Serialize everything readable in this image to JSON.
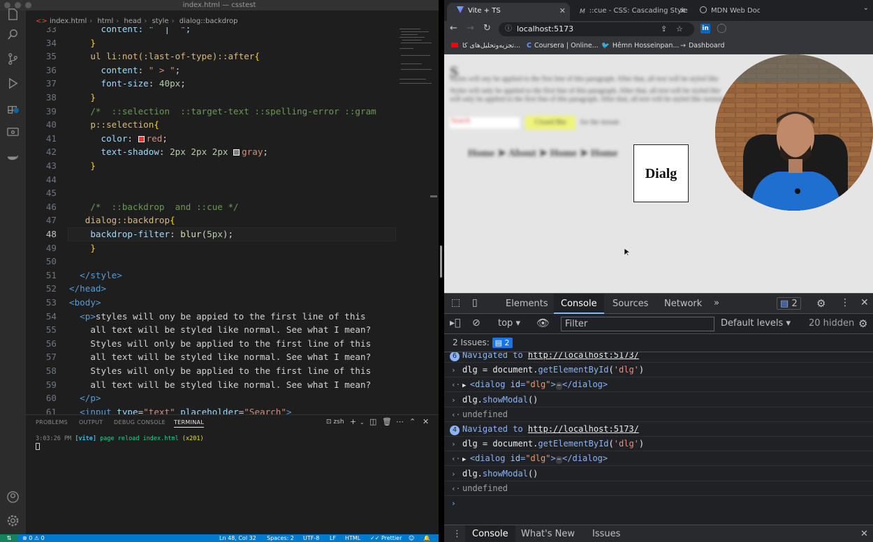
{
  "vscode": {
    "window_title": "index.html — csstest",
    "breadcrumbs": [
      "index.html",
      "html",
      "head",
      "style",
      "dialog::backdrop"
    ],
    "lines": [
      {
        "n": "33",
        "cur": false,
        "tokens": [
          {
            "t": "      content: \"  |  \";",
            "c": "t-prop"
          }
        ]
      },
      {
        "n": "34",
        "cur": false,
        "tokens": [
          {
            "t": "    }",
            "c": "t-br"
          }
        ]
      },
      {
        "n": "35",
        "cur": false,
        "tokens": [
          {
            "t": "    ul li:not(:last-of-type)::after",
            "c": "t-sel"
          },
          {
            "t": "{",
            "c": "t-br"
          }
        ]
      },
      {
        "n": "36",
        "cur": false,
        "tokens": [
          {
            "t": "      content",
            "c": "t-prop"
          },
          {
            "t": ": ",
            "c": ""
          },
          {
            "t": "\" > \"",
            "c": "t-str"
          },
          {
            "t": ";",
            "c": ""
          }
        ]
      },
      {
        "n": "37",
        "cur": false,
        "tokens": [
          {
            "t": "      font-size",
            "c": "t-prop"
          },
          {
            "t": ": ",
            "c": ""
          },
          {
            "t": "40px",
            "c": "t-num"
          },
          {
            "t": ";",
            "c": ""
          }
        ]
      },
      {
        "n": "38",
        "cur": false,
        "tokens": [
          {
            "t": "    }",
            "c": "t-br"
          }
        ]
      },
      {
        "n": "39",
        "cur": false,
        "tokens": [
          {
            "t": "    /*  ::selection  ::target-text ::spelling-error ::gram",
            "c": "t-cm"
          }
        ]
      },
      {
        "n": "40",
        "cur": false,
        "tokens": [
          {
            "t": "    p::selection",
            "c": "t-sel"
          },
          {
            "t": "{",
            "c": "t-br"
          }
        ]
      },
      {
        "n": "41",
        "cur": false,
        "swatch": "#e53935",
        "tokens": [
          {
            "t": "      color",
            "c": "t-prop"
          },
          {
            "t": ": ",
            "c": ""
          },
          {
            "t": "SW",
            "c": "swatch"
          },
          {
            "t": "red",
            "c": "t-str"
          },
          {
            "t": ";",
            "c": ""
          }
        ]
      },
      {
        "n": "42",
        "cur": false,
        "swatch": "#808080",
        "tokens": [
          {
            "t": "      text-shadow",
            "c": "t-prop"
          },
          {
            "t": ": ",
            "c": ""
          },
          {
            "t": "2px 2px 2px ",
            "c": "t-num"
          },
          {
            "t": "SW",
            "c": "swatch"
          },
          {
            "t": "gray",
            "c": "t-str"
          },
          {
            "t": ";",
            "c": ""
          }
        ]
      },
      {
        "n": "43",
        "cur": false,
        "tokens": [
          {
            "t": "    }",
            "c": "t-br"
          }
        ]
      },
      {
        "n": "44",
        "cur": false,
        "tokens": []
      },
      {
        "n": "45",
        "cur": false,
        "tokens": []
      },
      {
        "n": "46",
        "cur": false,
        "tokens": [
          {
            "t": "    /*  ::backdrop  and ::cue */",
            "c": "t-cm"
          }
        ]
      },
      {
        "n": "47",
        "cur": false,
        "tokens": [
          {
            "t": "   dialog::backdrop",
            "c": "t-sel"
          },
          {
            "t": "{",
            "c": "t-br"
          }
        ]
      },
      {
        "n": "48",
        "cur": true,
        "tokens": [
          {
            "t": "    backdrop-filter",
            "c": "t-prop"
          },
          {
            "t": ": ",
            "c": ""
          },
          {
            "t": "blur",
            "c": "t-fn"
          },
          {
            "t": "(",
            "c": ""
          },
          {
            "t": "5px",
            "c": "t-num"
          },
          {
            "t": ");",
            "c": ""
          }
        ]
      },
      {
        "n": "49",
        "cur": false,
        "tokens": [
          {
            "t": "    }",
            "c": "t-br"
          }
        ]
      },
      {
        "n": "50",
        "cur": false,
        "tokens": []
      },
      {
        "n": "51",
        "cur": false,
        "tokens": [
          {
            "t": "  </",
            "c": "t-tag"
          },
          {
            "t": "style",
            "c": "t-tag"
          },
          {
            "t": ">",
            "c": "t-tag"
          }
        ]
      },
      {
        "n": "52",
        "cur": false,
        "tokens": [
          {
            "t": "</",
            "c": "t-tag"
          },
          {
            "t": "head",
            "c": "t-tag"
          },
          {
            "t": ">",
            "c": "t-tag"
          }
        ]
      },
      {
        "n": "53",
        "cur": false,
        "tokens": [
          {
            "t": "<",
            "c": "t-tag"
          },
          {
            "t": "body",
            "c": "t-tag"
          },
          {
            "t": ">",
            "c": "t-tag"
          }
        ]
      },
      {
        "n": "54",
        "cur": false,
        "tokens": [
          {
            "t": "  <p>",
            "c": "t-tag"
          },
          {
            "t": "styles will ony be appied to the first line of this",
            "c": ""
          }
        ]
      },
      {
        "n": "55",
        "cur": false,
        "tokens": [
          {
            "t": "    all text will be styled like normal. See what I mean?",
            "c": ""
          }
        ]
      },
      {
        "n": "56",
        "cur": false,
        "tokens": [
          {
            "t": "    Styles will only be applied to the first line of this",
            "c": ""
          }
        ]
      },
      {
        "n": "57",
        "cur": false,
        "tokens": [
          {
            "t": "    all text will be styled like normal. See what I mean?",
            "c": ""
          }
        ]
      },
      {
        "n": "58",
        "cur": false,
        "tokens": [
          {
            "t": "    Styles will only be applied to the first line of this",
            "c": ""
          }
        ]
      },
      {
        "n": "59",
        "cur": false,
        "tokens": [
          {
            "t": "    all text will be styled like normal. See what I mean?",
            "c": ""
          }
        ]
      },
      {
        "n": "60",
        "cur": false,
        "tokens": [
          {
            "t": "  </p>",
            "c": "t-tag"
          }
        ]
      },
      {
        "n": "61",
        "cur": false,
        "tokens": [
          {
            "t": "  <input ",
            "c": "t-tag"
          },
          {
            "t": "type",
            "c": "t-attr"
          },
          {
            "t": "=",
            "c": ""
          },
          {
            "t": "\"text\"",
            "c": "t-str"
          },
          {
            "t": " placeholder",
            "c": "t-attr"
          },
          {
            "t": "=",
            "c": ""
          },
          {
            "t": "\"Search\"",
            "c": "t-str"
          },
          {
            "t": ">",
            "c": "t-tag"
          }
        ]
      }
    ],
    "panel": {
      "tabs": [
        "PROBLEMS",
        "OUTPUT",
        "DEBUG CONSOLE",
        "TERMINAL"
      ],
      "active_tab": "TERMINAL",
      "shell": "zsh",
      "terminal_time": "3:03:26 PM",
      "terminal_tag": "[vite]",
      "terminal_msg": "page reload index.html",
      "terminal_count": "(x201)"
    },
    "statusbar": {
      "errors": "0",
      "warnings": "0",
      "position": "Ln 48, Col 32",
      "spaces": "Spaces: 2",
      "encoding": "UTF-8",
      "eol": "LF",
      "language": "HTML",
      "formatter": "Prettier"
    }
  },
  "chrome": {
    "tabs": [
      {
        "label": "Vite + TS",
        "active": true
      },
      {
        "label": "::cue - CSS: Cascading Style Sheets",
        "active": false
      },
      {
        "label": "MDN Web Docs",
        "active": false
      }
    ],
    "url": "localhost:5173",
    "bookmarks": [
      "تجزیه‌وتحلیل‌های کا...",
      "Coursera | Online...",
      "Hêmn Hosseinpan...",
      "Dashboard"
    ],
    "page": {
      "dialog_text": "Dialg",
      "blur_heading": "S",
      "blur_para1": "Styles will ony be applied to the first line of this paragraph. After that, all text will be styled like",
      "blur_para2": "Styles will only be applied to the first line of this paragraph. After that, all text will be styled like",
      "blur_para3": "will only be applied to the first line of this paragraph. After that, all text will be styled like normal.",
      "blur_search": "Search",
      "blur_button": "Closed Btn",
      "blur_after": "for the stream",
      "blur_nav": "Home  ➤  About  ➤  Home  ➤  Home"
    },
    "devtools": {
      "tabs": [
        "Elements",
        "Console",
        "Sources",
        "Network"
      ],
      "active_tab": "Console",
      "message_count": "2",
      "context": "top",
      "filter_placeholder": "Filter",
      "levels": "Default levels",
      "hidden": "20 hidden",
      "issues_label": "2 Issues:",
      "issues_count": "2",
      "console_lines": [
        {
          "kind": "nav",
          "badge": "6",
          "text": "Navigated to ",
          "link": "http://localhost:5173/"
        },
        {
          "kind": "input",
          "pre": "dlg = document.",
          "fn": "getElementById",
          "arg": "'dlg'",
          "post": ")"
        },
        {
          "kind": "element",
          "open": "<dialog ",
          "attr": "id",
          "val": "\"dlg\"",
          "close": "</dialog>"
        },
        {
          "kind": "input",
          "pre": "dlg.",
          "fn": "showModal",
          "arg": "",
          "post": ")"
        },
        {
          "kind": "result",
          "text": "undefined"
        },
        {
          "kind": "nav",
          "badge": "4",
          "text": "Navigated to ",
          "link": "http://localhost:5173/"
        },
        {
          "kind": "input",
          "pre": "dlg = document.",
          "fn": "getElementById",
          "arg": "'dlg'",
          "post": ")"
        },
        {
          "kind": "element",
          "open": "<dialog ",
          "attr": "id",
          "val": "\"dlg\"",
          "close": "</dialog>"
        },
        {
          "kind": "input",
          "pre": "dlg.",
          "fn": "showModal",
          "arg": "",
          "post": ")"
        },
        {
          "kind": "result",
          "text": "undefined"
        },
        {
          "kind": "prompt",
          "text": ""
        }
      ],
      "drawer_tabs": [
        "Console",
        "What's New",
        "Issues"
      ]
    }
  }
}
